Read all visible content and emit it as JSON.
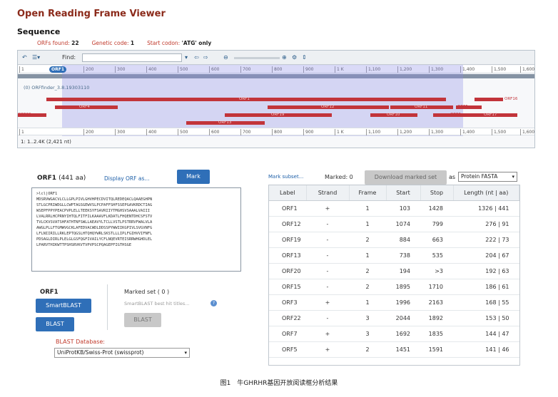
{
  "page_title": "Open Reading Frame Viewer",
  "sequence_heading": "Sequence",
  "stats": {
    "orfs_found_label": "ORFs found:",
    "orfs_found_value": "22",
    "genetic_code_label": "Genetic code:",
    "genetic_code_value": "1",
    "start_codon_label": "Start codon:",
    "start_codon_value": "'ATG' only"
  },
  "toolbar": {
    "find_label": "Find:",
    "zoom_level": ""
  },
  "ruler": {
    "marker_label": "ORF1",
    "ticks": [
      "1",
      "200",
      "300",
      "400",
      "500",
      "600",
      "700",
      "800",
      "900",
      "1 K",
      "1,100",
      "1,200",
      "1,300",
      "1,400",
      "1,500",
      "1,600"
    ]
  },
  "track_label": "(0) ORFfinder_3.8.19303110",
  "orfs": [
    {
      "name": "ORF1",
      "row": 1
    },
    {
      "name": "ORF16",
      "row": 1
    },
    {
      "name": "ORF4",
      "row": 2
    },
    {
      "name": "ORF12",
      "row": 2
    },
    {
      "name": "ORF11",
      "row": 2
    },
    {
      "name": "ORF5",
      "row": 2
    },
    {
      "name": "ORF20",
      "row": 3
    },
    {
      "name": "ORF19",
      "row": 3
    },
    {
      "name": "ORF10",
      "row": 3
    },
    {
      "name": "ORF6",
      "row": 3
    },
    {
      "name": "ORF17",
      "row": 3
    },
    {
      "name": "ORF13",
      "row": 4
    }
  ],
  "coord_range": "1: 1..2.4K (2,421 nt)",
  "orf_panel": {
    "name": "ORF1",
    "length": "(441 aa)",
    "display_link": "Display ORF as...",
    "mark_label": "Mark",
    "sequence": ">lcl|ORF1\nMDSRVWGACVLCLLGPLPIVLGHVHPECDVITQLREDEQACLQAAEGHPN\nSTLGCPRIWDGLLCWPTAGSGEWVSLPCPAFFSHFSSEPGAVKRDCTIAG\nWSEPFPPYPEACPVPLELLTEEKSYFSAVRIIYTMGHSVSAAALVAIII\nLVALRRLHCPRNYIHTQLFITFILKAAAVFLKDATLFHQENTDHCSFSTV\nTVLCKVSVATSHFATHTNFSWLLAEAVYLTCLLVSTLPSTRRVFWALVLA\nAWGLPLLFTGMWVGCKLAFEDVACWDLDDSSPYWWIIKGPIVLSVGVNFG\nLFLNIIRILLRKLEPTQGSLHTQHQYWRLSKSTLLLIPLFGIHVVIFNFL\nPDSAGLDIRLPLELGLGSFQGFIVAILYCFLNQEVRTEISRRWHGHDLEL\nLPARVTHIKWTTPSHSRVKVTVPVPSCPQAGEPFIGTHSGE"
  },
  "blast_panel": {
    "orf_label": "ORF1",
    "smartblast_label": "SmartBLAST",
    "blast_label": "BLAST",
    "marked_set_label": "Marked set ( 0 )",
    "smartblast_titles": "SmartBLAST best hit titles...",
    "blast_gray_label": "BLAST",
    "db_label": "BLAST Database:",
    "db_value": "UniProtKB/Swiss-Prot (swissprot)"
  },
  "table_controls": {
    "mark_subset": "Mark subset...",
    "marked_count": "Marked: 0",
    "download_label": "Download marked set",
    "as_label": "as",
    "format_value": "Protein FASTA"
  },
  "table": {
    "headers": [
      "Label",
      "Strand",
      "Frame",
      "Start",
      "Stop",
      "Length (nt | aa)"
    ],
    "rows": [
      [
        "ORF1",
        "+",
        "1",
        "103",
        "1428",
        "1326 | 441"
      ],
      [
        "ORF12",
        "-",
        "1",
        "1074",
        "799",
        "276 | 91"
      ],
      [
        "ORF19",
        "-",
        "2",
        "884",
        "663",
        "222 | 73"
      ],
      [
        "ORF13",
        "-",
        "1",
        "738",
        "535",
        "204 | 67"
      ],
      [
        "ORF20",
        "-",
        "2",
        "194",
        ">3",
        "192 | 63"
      ],
      [
        "ORF15",
        "-",
        "2",
        "1895",
        "1710",
        "186 | 61"
      ],
      [
        "ORF3",
        "+",
        "1",
        "1996",
        "2163",
        "168 | 55"
      ],
      [
        "ORF22",
        "-",
        "3",
        "2044",
        "1892",
        "153 | 50"
      ],
      [
        "ORF7",
        "+",
        "3",
        "1692",
        "1835",
        "144 | 47"
      ],
      [
        "ORF5",
        "+",
        "2",
        "1451",
        "1591",
        "141 | 46"
      ]
    ]
  },
  "caption": "图1　牛GHRHR基因开放阅读框分析结果"
}
